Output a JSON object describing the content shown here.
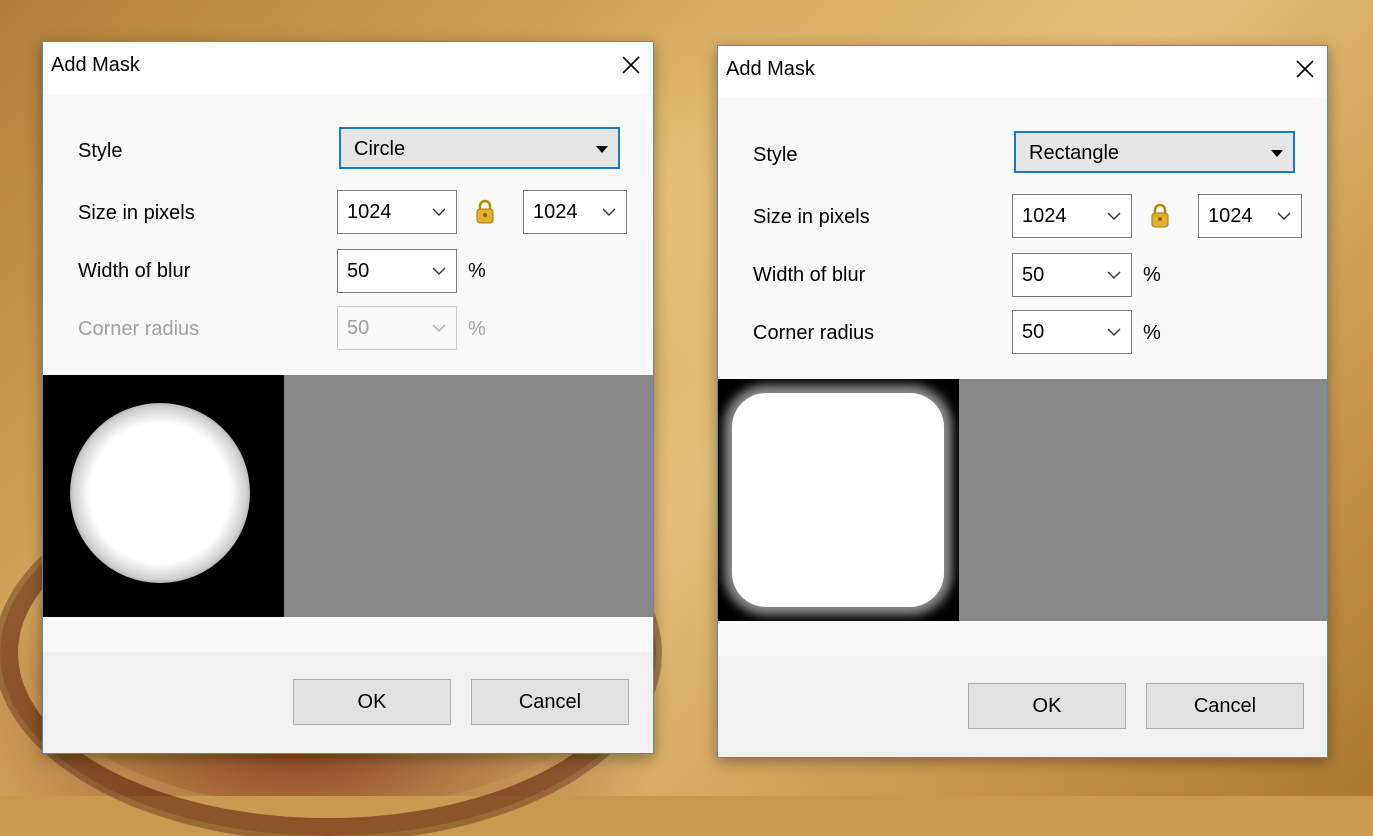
{
  "dialogs": [
    {
      "title": "Add Mask",
      "labels": {
        "style": "Style",
        "size": "Size in pixels",
        "blur": "Width of blur",
        "corner": "Corner radius"
      },
      "style_value": "Circle",
      "width_value": "1024",
      "height_value": "1024",
      "blur_value": "50",
      "blur_unit": "%",
      "corner_value": "50",
      "corner_unit": "%",
      "corner_enabled": false,
      "preview_shape": "circle",
      "buttons": {
        "ok": "OK",
        "cancel": "Cancel"
      }
    },
    {
      "title": "Add Mask",
      "labels": {
        "style": "Style",
        "size": "Size in pixels",
        "blur": "Width of blur",
        "corner": "Corner radius"
      },
      "style_value": "Rectangle",
      "width_value": "1024",
      "height_value": "1024",
      "blur_value": "50",
      "blur_unit": "%",
      "corner_value": "50",
      "corner_unit": "%",
      "corner_enabled": true,
      "preview_shape": "rounded-rectangle",
      "buttons": {
        "ok": "OK",
        "cancel": "Cancel"
      }
    }
  ],
  "colors": {
    "accent_border": "#1979ca",
    "preview_background": "#888888",
    "mask_black": "#000000",
    "lock_icon": "#d4a017"
  },
  "icons": {
    "close": "close-icon",
    "dropdown": "dropdown-arrow-icon",
    "chevron": "chevron-down-icon",
    "lock": "lock-icon"
  }
}
